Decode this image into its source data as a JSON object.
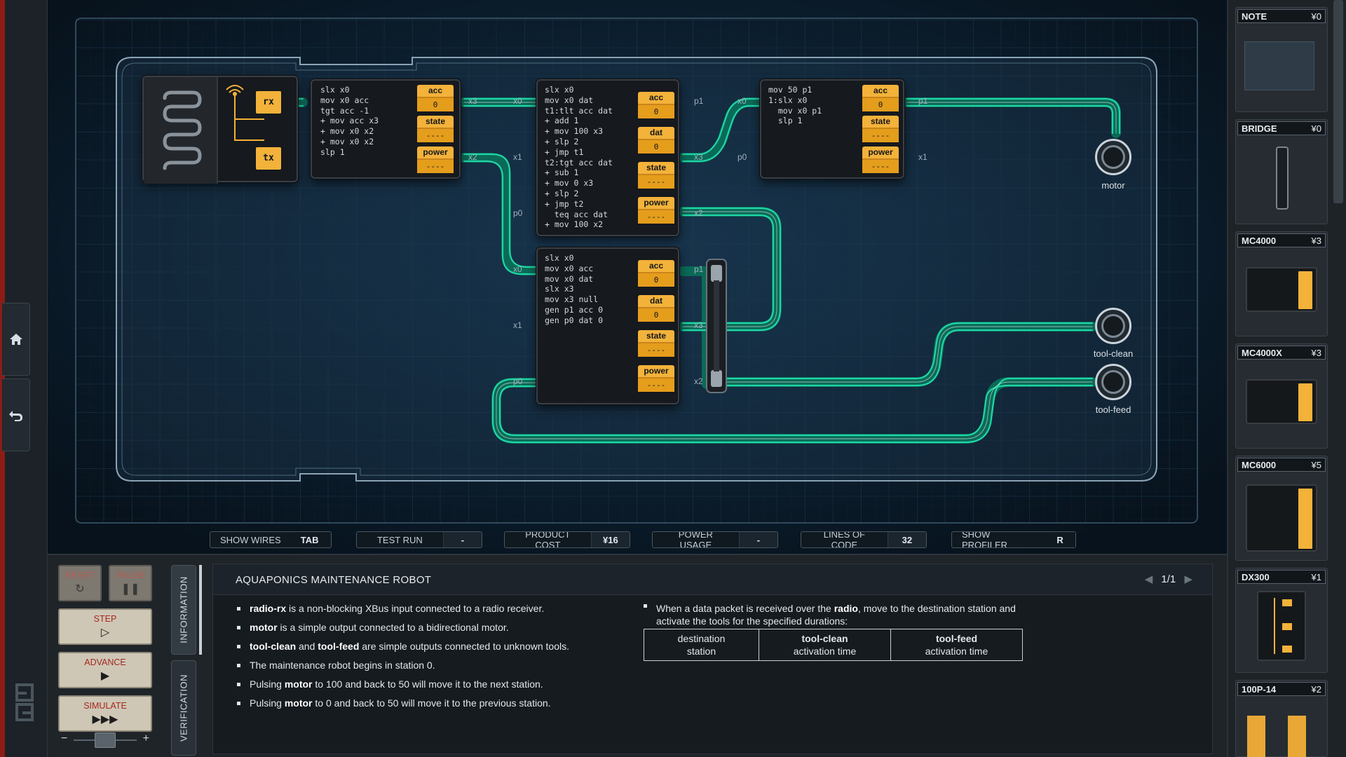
{
  "left_rail": {
    "home_icon": "home-icon",
    "undo_icon": "undo-icon",
    "logo": "S\nE"
  },
  "board": {
    "radio_chip": {
      "rx": "rx",
      "tx": "tx"
    },
    "chip_a": {
      "code": "slx x0\nmov x0 acc\ntgt acc -1\n+ mov acc x3\n+ mov x0 x2\n+ mov x0 x2\nslp 1",
      "regs": [
        {
          "name": "acc",
          "value": "0"
        },
        {
          "name": "state",
          "value": "----"
        },
        {
          "name": "power",
          "value": "----"
        }
      ],
      "pins": {
        "x3": "x3",
        "x2": "x2"
      }
    },
    "chip_b": {
      "code": "slx x0\nmov x0 dat\nt1:tlt acc dat\n+ add 1\n+ mov 100 x3\n+ slp 2\n+ jmp t1\nt2:tgt acc dat\n+ sub 1\n+ mov 0 x3\n+ slp 2\n+ jmp t2\n  teq acc dat\n+ mov 100 x2",
      "regs": [
        {
          "name": "acc",
          "value": "0"
        },
        {
          "name": "dat",
          "value": "0"
        },
        {
          "name": "state",
          "value": "----"
        },
        {
          "name": "power",
          "value": "----"
        }
      ],
      "pins": {
        "x0": "x0",
        "x1": "x1",
        "p0": "p0",
        "p1": "p1",
        "x3": "x3",
        "x2": "x2"
      }
    },
    "chip_c": {
      "code": "mov 50 p1\n1:slx x0\n  mov x0 p1\n  slp 1",
      "regs": [
        {
          "name": "acc",
          "value": "0"
        },
        {
          "name": "state",
          "value": "----"
        },
        {
          "name": "power",
          "value": "----"
        }
      ],
      "pins": {
        "x0": "x0",
        "p0": "p0",
        "p1": "p1",
        "x1": "x1"
      }
    },
    "chip_d": {
      "code": "slx x0\nmov x0 acc\nmov x0 dat\nslx x3\nmov x3 null\ngen p1 acc 0\ngen p0 dat 0",
      "regs": [
        {
          "name": "acc",
          "value": "0"
        },
        {
          "name": "dat",
          "value": "0"
        },
        {
          "name": "state",
          "value": "----"
        },
        {
          "name": "power",
          "value": "----"
        }
      ],
      "pins": {
        "x0": "x0",
        "x1": "x1",
        "p0": "p0",
        "p1": "p1",
        "x3": "x3",
        "x2": "x2"
      }
    },
    "tools": {
      "motor": "motor",
      "tool_clean": "tool-clean",
      "tool_feed": "tool-feed"
    },
    "wire_color": "#1fd6a6"
  },
  "toolbar": {
    "show_wires": {
      "label": "SHOW WIRES",
      "value": "TAB"
    },
    "test_run": {
      "label": "TEST RUN",
      "value": "-"
    },
    "product_cost": {
      "label": "PRODUCT COST",
      "value": "¥16"
    },
    "power_usage": {
      "label": "POWER USAGE",
      "value": "-"
    },
    "lines_of_code": {
      "label": "LINES OF CODE",
      "value": "32"
    },
    "show_profiler": {
      "label": "SHOW PROFILER",
      "value": "R"
    }
  },
  "controls": {
    "reset": "RESET",
    "pause": "PAUSE",
    "step": "STEP",
    "advance": "ADVANCE",
    "simulate": "SIMULATE",
    "speed_minus": "−",
    "speed_plus": "+"
  },
  "tabs": {
    "information": "INFORMATION",
    "verification": "VERIFICATION"
  },
  "doc": {
    "title": "AQUAPONICS MAINTENANCE ROBOT",
    "page": "1/1",
    "left_bullets": [
      {
        "b": "radio-rx",
        "t": " is a non-blocking XBus input connected to a radio receiver."
      },
      {
        "b": "motor",
        "t": " is a simple output connected to a bidirectional motor."
      },
      {
        "b": "tool-clean",
        "t": " and ",
        "b2": "tool-feed",
        "t2": " are simple outputs connected to unknown tools."
      },
      {
        "b": "",
        "t": "The maintenance robot begins in station 0."
      },
      {
        "pre": "Pulsing ",
        "b": "motor",
        "t": " to 100 and back to 50 will move it to the next station."
      },
      {
        "pre": "Pulsing ",
        "b": "motor",
        "t": " to 0 and back to 50 will move it to the previous station."
      }
    ],
    "right_bullet_pre": "When a data packet is received over the ",
    "right_bullet_b": "radio",
    "right_bullet_post": ", move to the destination station and activate the tools for the specified durations:",
    "table": [
      {
        "l1": "destination",
        "l2": "station",
        "bold": false
      },
      {
        "l1": "tool-clean",
        "l2": "activation time",
        "bold": true
      },
      {
        "l1": "tool-feed",
        "l2": "activation time",
        "bold": true
      }
    ]
  },
  "parts": [
    {
      "name": "NOTE",
      "price": "¥0"
    },
    {
      "name": "BRIDGE",
      "price": "¥0"
    },
    {
      "name": "MC4000",
      "price": "¥3"
    },
    {
      "name": "MC4000X",
      "price": "¥3"
    },
    {
      "name": "MC6000",
      "price": "¥5"
    },
    {
      "name": "DX300",
      "price": "¥1"
    },
    {
      "name": "100P-14",
      "price": "¥2"
    }
  ]
}
